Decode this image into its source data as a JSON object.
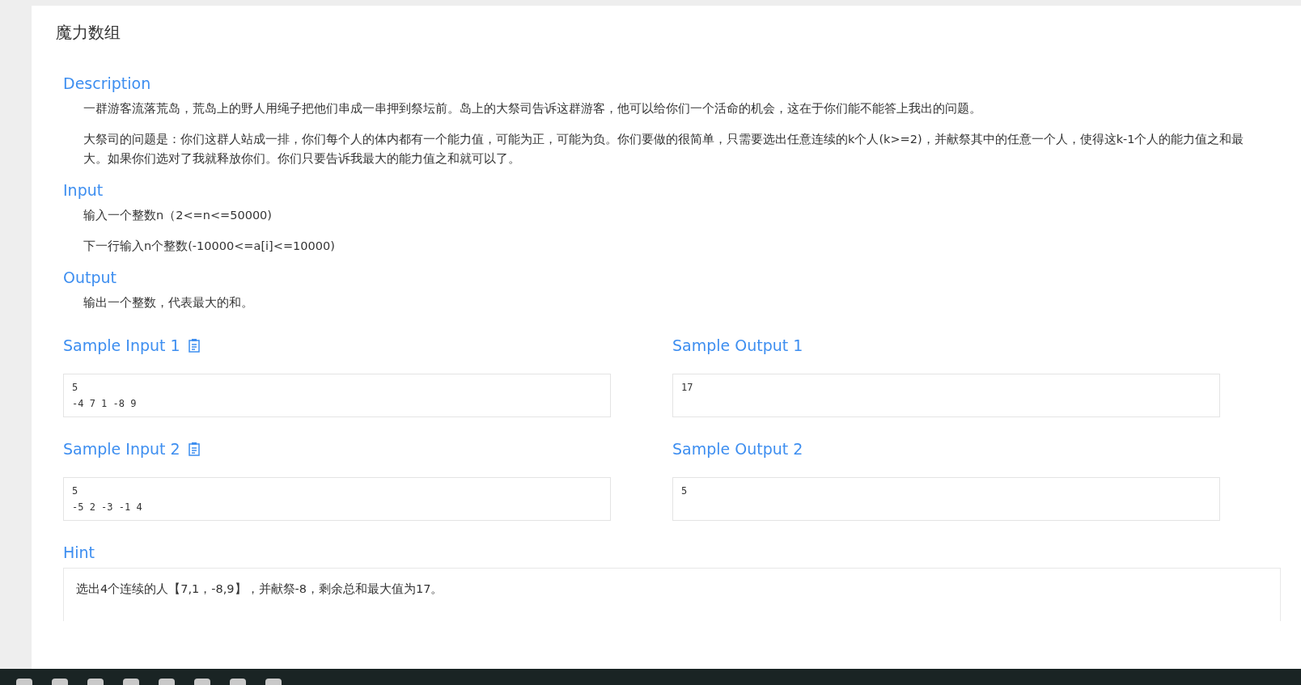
{
  "title": "魔力数组",
  "sections": [
    {
      "heading": "Description",
      "paragraphs": [
        "一群游客流落荒岛，荒岛上的野人用绳子把他们串成一串押到祭坛前。岛上的大祭司告诉这群游客，他可以给你们一个活命的机会，这在于你们能不能答上我出的问题。",
        "大祭司的问题是：你们这群人站成一排，你们每个人的体内都有一个能力值，可能为正，可能为负。你们要做的很简单，只需要选出任意连续的k个人(k>=2)，并献祭其中的任意一个人，使得这k-1个人的能力值之和最大。如果你们选对了我就释放你们。你们只要告诉我最大的能力值之和就可以了。"
      ]
    },
    {
      "heading": "Input",
      "paragraphs": [
        "输入一个整数n（2<=n<=50000)",
        "下一行输入n个整数(-10000<=a[i]<=10000)"
      ]
    },
    {
      "heading": "Output",
      "paragraphs": [
        "输出一个整数，代表最大的和。"
      ]
    }
  ],
  "samples": [
    {
      "input_heading": "Sample Input 1",
      "input": "5\n-4 7 1 -8 9",
      "output_heading": "Sample Output 1",
      "output": "17"
    },
    {
      "input_heading": "Sample Input 2",
      "input": "5\n-5 2 -3 -1 4",
      "output_heading": "Sample Output 2",
      "output": "5"
    }
  ],
  "hint": {
    "heading": "Hint",
    "text": "选出4个连续的人【7,1，-8,9】，并献祭-8，剩余总和最大值为17。"
  }
}
